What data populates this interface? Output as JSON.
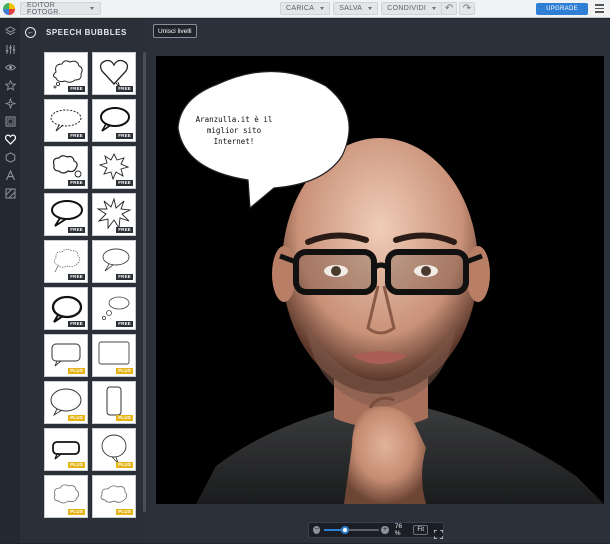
{
  "topbar": {
    "editor_label": "EDITOR FOTOGR.",
    "actions": [
      {
        "label": "CARICA",
        "name": "carica-menu"
      },
      {
        "label": "SALVA",
        "name": "salva-menu"
      },
      {
        "label": "CONDIVIDI",
        "name": "condividi-menu"
      }
    ],
    "undo_icon": "undo-icon",
    "redo_icon": "redo-icon",
    "upgrade_label": "UPGRADE",
    "menu_icon": "hamburger-menu-icon",
    "accent_color": "#2f7fd4"
  },
  "rail": {
    "icons": [
      "layers-icon",
      "sliders-icon",
      "eye-icon",
      "star-icon",
      "sparkle-icon",
      "frame-icon",
      "heart-icon",
      "hexagon-icon",
      "text-icon",
      "texture-icon"
    ],
    "active": "heart-icon"
  },
  "panel": {
    "title": "SPEECH BUBBLES",
    "back_icon": "back-arrow-icon",
    "items": [
      {
        "badge": "FREE",
        "style": "cloud"
      },
      {
        "badge": "FREE",
        "style": "heart"
      },
      {
        "badge": "FREE",
        "style": "oval-dashed"
      },
      {
        "badge": "FREE",
        "style": "oval-bold"
      },
      {
        "badge": "FREE",
        "style": "cloud-two"
      },
      {
        "badge": "FREE",
        "style": "spiky-small"
      },
      {
        "badge": "FREE",
        "style": "oval-bold-tail"
      },
      {
        "badge": "FREE",
        "style": "explosion"
      },
      {
        "badge": "FREE",
        "style": "sketch-cloud"
      },
      {
        "badge": "FREE",
        "style": "sketch-oval"
      },
      {
        "badge": "FREE",
        "style": "oval-thick"
      },
      {
        "badge": "FREE",
        "style": "thought"
      },
      {
        "badge": "PLUS",
        "style": "rounded-rect"
      },
      {
        "badge": "PLUS",
        "style": "sketch-rect"
      },
      {
        "badge": "PLUS",
        "style": "oval-thin"
      },
      {
        "badge": "PLUS",
        "style": "tall-rect"
      },
      {
        "badge": "PLUS",
        "style": "rect-shadow"
      },
      {
        "badge": "PLUS",
        "style": "oval-up"
      },
      {
        "badge": "PLUS",
        "style": "cloud-light"
      },
      {
        "badge": "PLUS",
        "style": "cloud-light-2"
      }
    ]
  },
  "workspace": {
    "merge_label": "Unisci livelli",
    "bubble_text": "Aranzulla.it è il miglior sito Internet!",
    "zoom": {
      "value_label": "76 %",
      "value": 0.76,
      "fit_label": "Fit",
      "minus_icon": "zoom-out-icon",
      "plus_icon": "zoom-in-icon",
      "fullscreen_icon": "fullscreen-icon"
    }
  }
}
